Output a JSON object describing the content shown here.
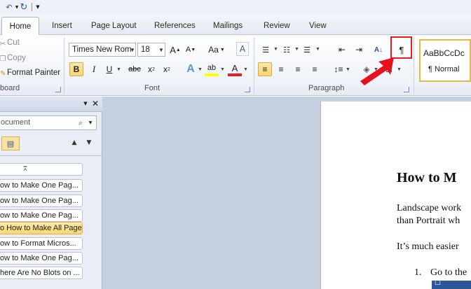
{
  "quick_access": {
    "undo_icon": "undo-icon",
    "redo_icon": "redo-icon",
    "customize_icon": "customize-icon"
  },
  "tabs": [
    {
      "label": "Home",
      "active": true
    },
    {
      "label": "Insert"
    },
    {
      "label": "Page Layout"
    },
    {
      "label": "References"
    },
    {
      "label": "Mailings"
    },
    {
      "label": "Review"
    },
    {
      "label": "View"
    }
  ],
  "clipboard": {
    "cut": "Cut",
    "copy": "Copy",
    "format_painter": "Format Painter",
    "group_label": "board"
  },
  "font": {
    "name": "Times New Rom",
    "size": "18",
    "group_label": "Font",
    "grow": "A",
    "shrink": "A",
    "change_case": "Aa",
    "bold": "B",
    "italic": "I",
    "underline": "U",
    "strikethrough": "abc",
    "subscript": "x",
    "superscript": "x",
    "text_effects": "A",
    "highlight": "ab",
    "font_color": "A"
  },
  "paragraph": {
    "group_label": "Paragraph",
    "show_hide": "¶"
  },
  "styles": {
    "normal_preview": "AaBbCcDc",
    "normal_label": "¶ Normal"
  },
  "nav": {
    "search_placeholder": "ocument",
    "items": [
      "ow to Make One Pag...",
      "ow to Make One Pag...",
      "ow to Make One Pag...",
      "o How to Make All Pages...",
      "ow to Format Micros...",
      "ow to Make One Pag...",
      "here Are No Blots on ..."
    ],
    "selected_index": 3
  },
  "document": {
    "heading": "How to M",
    "para1_line1": "Landscape work",
    "para1_line2": "than Portrait wh",
    "para2": "It’s much easier",
    "list_number": "1.",
    "list_text": "Go to the"
  },
  "colors": {
    "accent": "#2b579a",
    "highlight_box": "#e02020",
    "arrow": "#e8101a",
    "selected": "#fbd76f"
  }
}
